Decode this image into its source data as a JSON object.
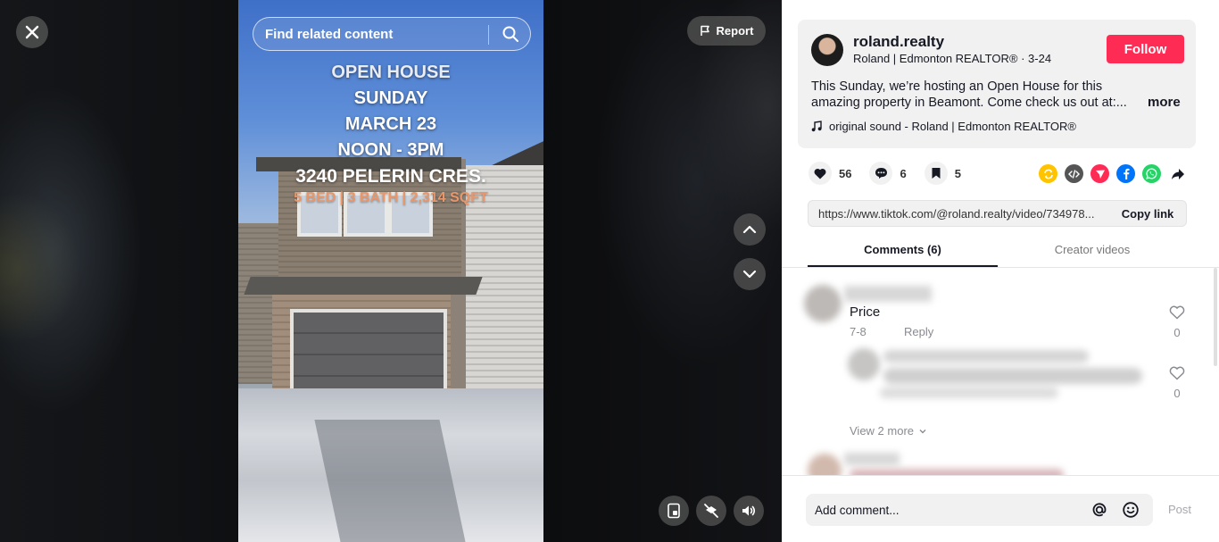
{
  "viewer": {
    "report_label": "Report",
    "search_placeholder": "Find related content",
    "overlay": {
      "line1": "OPEN HOUSE",
      "line2": "SUNDAY",
      "line3": "MARCH 23",
      "line4": "NOON - 3PM",
      "line5": "3240 PELERIN CRES.",
      "line6": "5 BED | 3 BATH | 2,314 SQFT"
    }
  },
  "post": {
    "username": "roland.realty",
    "display_name": "Roland | Edmonton REALTOR®",
    "date": "3-24",
    "follow_label": "Follow",
    "description": "This Sunday, we’re hosting an Open House for this amazing property in Beamont. Come check us out at:...",
    "more_label": "more",
    "sound": "original sound - Roland | Edmonton REALTOR®"
  },
  "stats": {
    "likes": "56",
    "comments": "6",
    "saves": "5"
  },
  "share_icons": [
    "repost-icon",
    "embed-icon",
    "send-icon",
    "facebook-icon",
    "whatsapp-icon",
    "share-arrow-icon"
  ],
  "colors": {
    "accent": "#fe2c55",
    "repost": "#ffc300",
    "embed": "#555555",
    "send": "#fe2c55",
    "facebook": "#0075fa",
    "whatsapp": "#25d366"
  },
  "link": {
    "url": "https://www.tiktok.com/@roland.realty/video/734978...",
    "copy_label": "Copy link"
  },
  "tabs": {
    "comments": "Comments (6)",
    "creator": "Creator videos"
  },
  "comments": [
    {
      "text": "Price",
      "date": "7-8",
      "reply_label": "Reply",
      "likes": "0"
    },
    {
      "likes": "0"
    }
  ],
  "view_more_label": "View 2 more",
  "composer": {
    "placeholder": "Add comment...",
    "post_label": "Post"
  }
}
